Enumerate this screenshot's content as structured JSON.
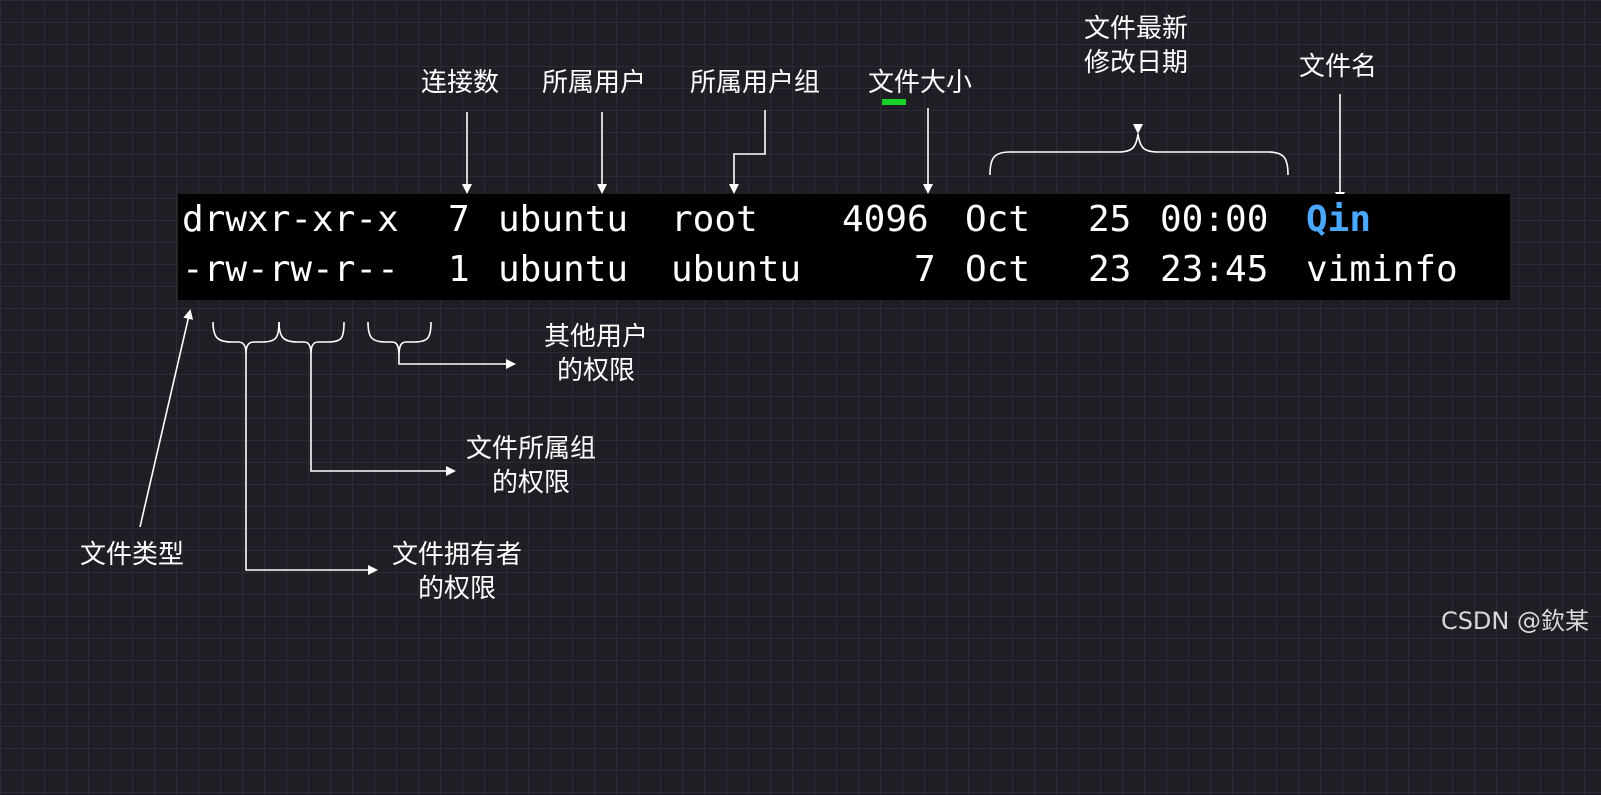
{
  "terminal": {
    "rows": [
      {
        "permissions": "drwxr-xr-x",
        "links": "7",
        "owner": "ubuntu",
        "group": "root",
        "size": "4096",
        "month": "Oct",
        "day": "25",
        "time": "00:00",
        "name": "Qin"
      },
      {
        "permissions": "-rw-rw-r--",
        "links": "1",
        "owner": "ubuntu",
        "group": "ubuntu",
        "size": "7",
        "month": "Oct",
        "day": "23",
        "time": "23:45",
        "name": "viminfo"
      }
    ],
    "directory_name_color": "#4aa8ff",
    "cursor_color": "#18d42a"
  },
  "labels": {
    "links": "连接数",
    "owner": "所属用户",
    "group": "所属用户组",
    "size": "文件大小",
    "mtime_line1": "文件最新",
    "mtime_line2": "修改日期",
    "filename": "文件名",
    "others_line1": "其他用户",
    "others_line2": "的权限",
    "group_perm_line1": "文件所属组",
    "group_perm_line2": "的权限",
    "file_type": "文件类型",
    "owner_perm_line1": "文件拥有者",
    "owner_perm_line2": "的权限"
  },
  "watermark": "CSDN @欽某"
}
